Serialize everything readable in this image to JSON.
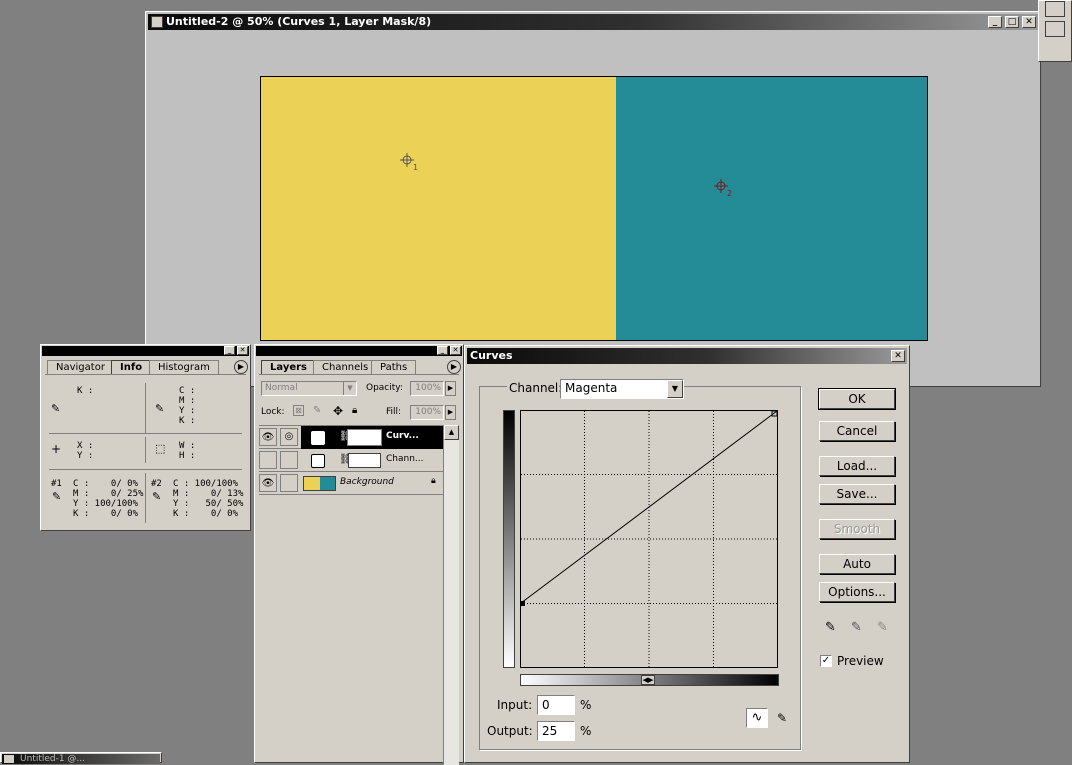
{
  "document": {
    "title": "Untitled-2 @ 50% (Curves 1, Layer Mask/8)",
    "canvas": {
      "left_color": "#ebd155",
      "right_color": "#238c97"
    },
    "samplers": [
      {
        "label": "1"
      },
      {
        "label": "2"
      }
    ]
  },
  "info_panel": {
    "tabs": [
      {
        "label": "Navigator"
      },
      {
        "label": "Info"
      },
      {
        "label": "Histogram"
      }
    ],
    "k_label": "K :",
    "cmyk_labels": [
      "C :",
      "M :",
      "Y :",
      "K :"
    ],
    "xy_labels": [
      "X :",
      "Y :"
    ],
    "wh_labels": [
      "W :",
      "H :"
    ],
    "sampler1": {
      "id": "#1",
      "lines": [
        "C :    0/ 0%",
        "M :    0/ 25%",
        "Y : 100/100%",
        "K :    0/ 0%"
      ]
    },
    "sampler2": {
      "id": "#2",
      "lines": [
        "C : 100/100%",
        "M :    0/ 13%",
        "Y :   50/ 50%",
        "K :    0/ 0%"
      ]
    }
  },
  "layers_panel": {
    "tabs": [
      {
        "label": "Layers"
      },
      {
        "label": "Channels"
      },
      {
        "label": "Paths"
      }
    ],
    "blend_mode": "Normal",
    "opacity_label": "Opacity:",
    "opacity_value": "100%",
    "lock_label": "Lock:",
    "fill_label": "Fill:",
    "fill_value": "100%",
    "layers": [
      {
        "name": "Curv..."
      },
      {
        "name": "Chann..."
      },
      {
        "name": "Background"
      }
    ]
  },
  "curves_dialog": {
    "title": "Curves",
    "channel_label": "Channel:",
    "channel_value": "Magenta",
    "buttons": {
      "ok": "OK",
      "cancel": "Cancel",
      "load": "Load...",
      "save": "Save...",
      "smooth": "Smooth",
      "auto": "Auto",
      "options": "Options..."
    },
    "preview_label": "Preview",
    "preview_checked": true,
    "input_label": "Input:",
    "input_value": "0",
    "output_label": "Output:",
    "output_value": "25",
    "percent": "%",
    "curve": {
      "points": [
        {
          "input": 0,
          "output": 25
        },
        {
          "input": 100,
          "output": 100
        }
      ]
    }
  },
  "bottom_window": {
    "title": "Untitled-1 @..."
  }
}
